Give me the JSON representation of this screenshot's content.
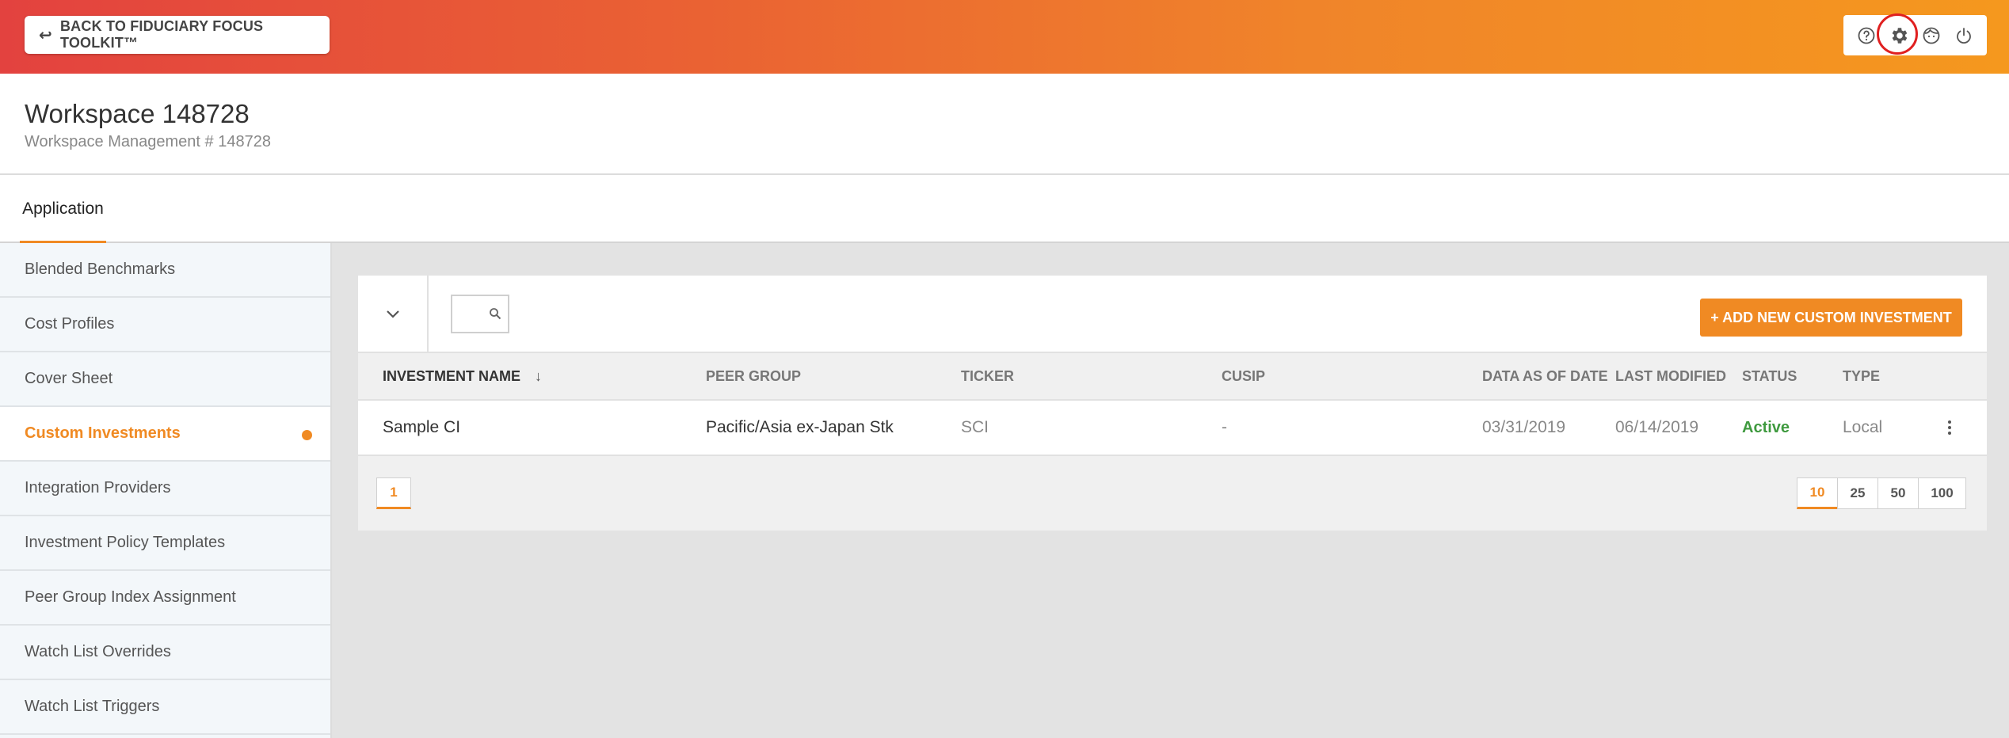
{
  "header": {
    "back_label": "BACK TO FIDUCIARY FOCUS TOOLKIT™",
    "back_arrow": "↩",
    "accent": "#f08a23"
  },
  "workspace": {
    "title": "Workspace 148728",
    "subtitle": "Workspace Management # 148728"
  },
  "tabs": [
    {
      "label": "Application"
    }
  ],
  "sidebar": {
    "items": [
      {
        "label": "Blended Benchmarks"
      },
      {
        "label": "Cost Profiles"
      },
      {
        "label": "Cover Sheet"
      },
      {
        "label": "Custom Investments",
        "active": true
      },
      {
        "label": "Integration Providers"
      },
      {
        "label": "Investment Policy Templates"
      },
      {
        "label": "Peer Group Index Assignment"
      },
      {
        "label": "Watch List Overrides"
      },
      {
        "label": "Watch List Triggers"
      }
    ]
  },
  "toolbar": {
    "add_label": "+ ADD NEW CUSTOM INVESTMENT",
    "search_value": ""
  },
  "table": {
    "columns": [
      "INVESTMENT NAME",
      "PEER GROUP",
      "TICKER",
      "CUSIP",
      "DATA AS OF DATE",
      "LAST MODIFIED",
      "STATUS",
      "TYPE"
    ],
    "sort_indicator": "↓",
    "rows": [
      {
        "name": "Sample CI",
        "peer_group": "Pacific/Asia ex-Japan Stk",
        "ticker": "SCI",
        "cusip": "-",
        "data_as_of": "03/31/2019",
        "last_modified": "06/14/2019",
        "status": "Active",
        "type": "Local"
      }
    ]
  },
  "pagination": {
    "current_page": "1",
    "page_sizes": [
      "10",
      "25",
      "50",
      "100"
    ],
    "selected_size": "10"
  },
  "icons": {
    "tools": [
      "help-icon",
      "settings-gear-icon",
      "user-face-icon",
      "power-icon"
    ]
  }
}
